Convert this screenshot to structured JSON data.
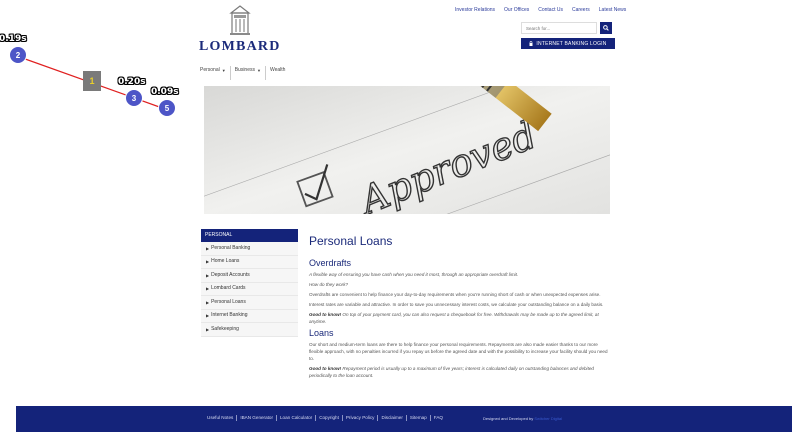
{
  "brand": {
    "name": "LOMBARD"
  },
  "top_links": [
    "Investor Relations",
    "Our Offices",
    "Contact Us",
    "Careers",
    "Latest News"
  ],
  "search": {
    "placeholder": "Search for..."
  },
  "login": {
    "label": "INTERNET BANKING LOGIN"
  },
  "main_nav": [
    {
      "label": "Personal",
      "dropdown": true
    },
    {
      "label": "Business",
      "dropdown": true
    },
    {
      "label": "Wealth",
      "dropdown": false
    }
  ],
  "hero": {
    "text": "Approved"
  },
  "sidebar": {
    "heading": "PERSONAL",
    "items": [
      "Personal Banking",
      "Home Loans",
      "Deposit Accounts",
      "Lombard Cards",
      "Personal Loans",
      "Internet Banking",
      "Safekeeping"
    ]
  },
  "content": {
    "title": "Personal Loans",
    "overdrafts": {
      "heading": "Overdrafts",
      "intro": "A flexible way of ensuring you have cash when you need it most, through an appropriate overdraft limit.",
      "question": "How do they work?",
      "p1": "Overdrafts are convenient to help finance your day-to-day requirements when you're running short of cash or when unexpected expenses arise.",
      "p2": "Interest rates are variable and attractive.  In order to save you unnecessary interest costs, we calculate your outstanding balance on a daily basis.",
      "tip_label": "Good to know!",
      "tip": " On top of your payment card, you can also request a chequebook for free. Withdrawals may be made up to the agreed limit, at anytime."
    },
    "loans": {
      "heading": "Loans",
      "p1": "Our short and medium-term loans are there to help finance your personal requirements. Repayments are also made easier thanks to our more flexible approach, with no penalties incurred if you repay us before the agreed date and with the possibility to increase your facility should you need to.",
      "tip_label": "Good to know!",
      "tip": " Repayment period is usually up to a maximum of five years; interest is calculated daily on outstanding balances and debited periodically to the loan account."
    }
  },
  "footer": {
    "links": [
      "Useful Notes",
      "IBAN Generator",
      "Loan Calculator",
      "Copyright",
      "Privacy Policy",
      "Disclaimer",
      "Sitemap",
      "FAQ"
    ],
    "credit": "Designed and Developed by",
    "credit_brand": "Switcher Digital"
  },
  "overlay": {
    "step_label": "1",
    "markers": [
      {
        "label": "2",
        "time": "0.19s"
      },
      {
        "label": "3",
        "time": "0.20s"
      },
      {
        "label": "5",
        "time": "0.09s"
      }
    ]
  },
  "colors": {
    "primary": "#14237a",
    "accent": "#1b2a7a",
    "overlay_marker": "#4d55c7",
    "overlay_line": "#e02020"
  }
}
